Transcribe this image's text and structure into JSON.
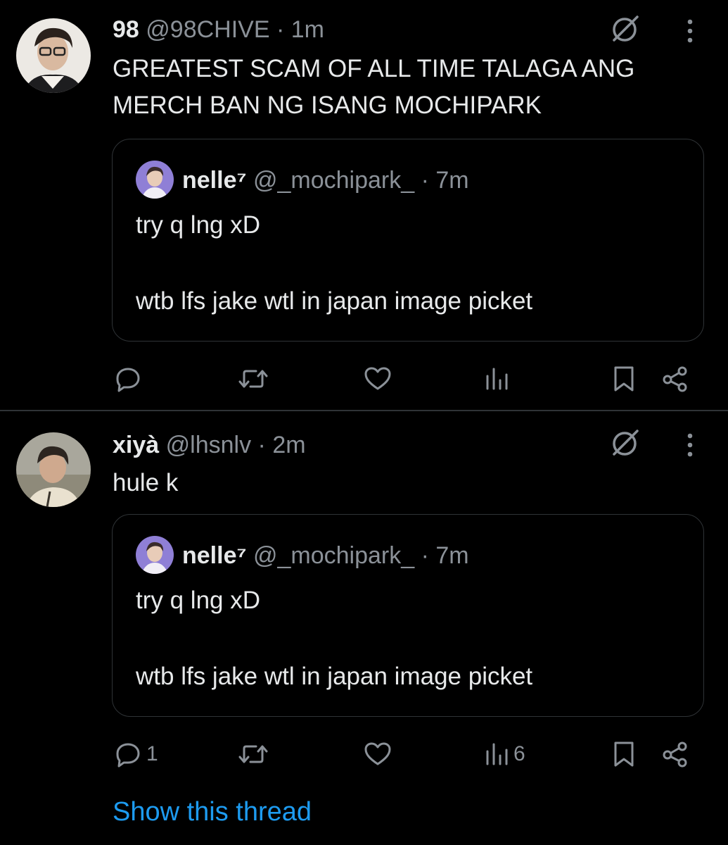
{
  "tweets": [
    {
      "display_name": "98",
      "handle": "@98CHIVE",
      "separator": "·",
      "time": "1m",
      "text": "GREATEST SCAM OF ALL TIME TALAGA ANG\nMERCH BAN NG ISANG MOCHIPARK",
      "quote": {
        "display_name": "nelle⁷",
        "handle": "@_mochipark_",
        "separator": "·",
        "time": "7m",
        "line1": "try q lng xD",
        "line2": "wtb lfs jake wtl in japan image picket"
      },
      "reply_count": "",
      "views_count": ""
    },
    {
      "display_name": "xiyà",
      "handle": "@lhsnlv",
      "separator": "·",
      "time": "2m",
      "text": "hule k",
      "quote": {
        "display_name": "nelle⁷",
        "handle": "@_mochipark_",
        "separator": "·",
        "time": "7m",
        "line1": "try q lng xD",
        "line2": "wtb lfs jake wtl in japan image picket"
      },
      "reply_count": "1",
      "views_count": "6"
    }
  ],
  "show_thread_label": "Show this thread",
  "icons": [
    "grok-icon",
    "more-icon",
    "reply-icon",
    "retweet-icon",
    "like-icon",
    "views-icon",
    "bookmark-icon",
    "share-icon"
  ],
  "colors": {
    "background": "#000000",
    "text": "#e7e9ea",
    "secondary": "#8b9198",
    "link": "#1d9bf0",
    "border": "#2f3336"
  }
}
